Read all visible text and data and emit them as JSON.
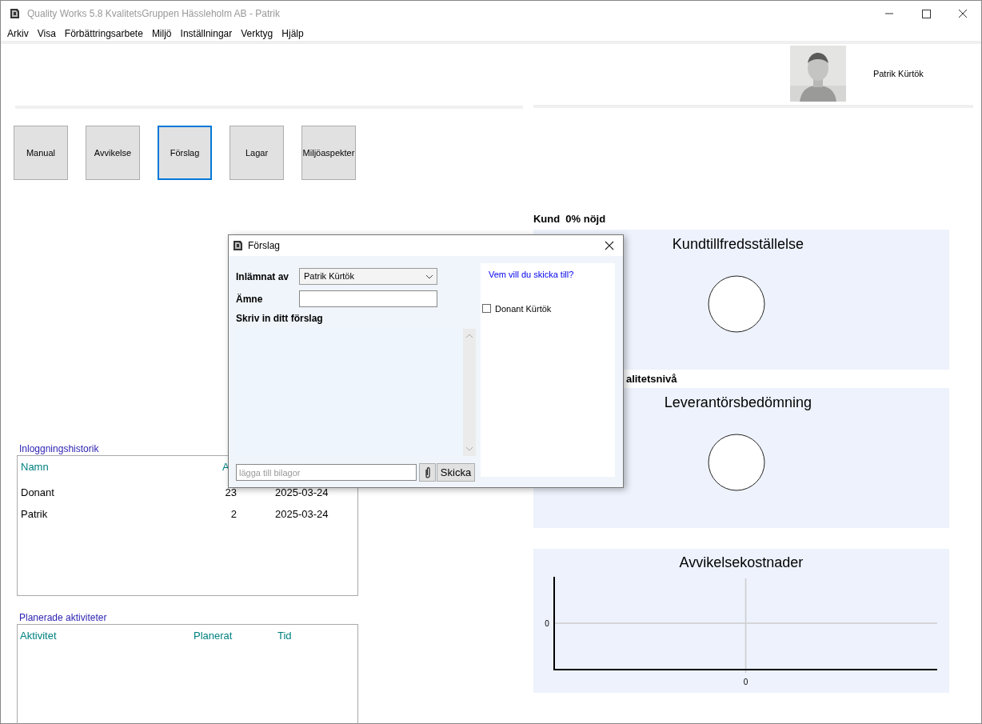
{
  "window": {
    "title": "Quality Works 5.8 KvalitetsGruppen Hässleholm AB - Patrik"
  },
  "menu": [
    "Arkiv",
    "Visa",
    "Förbättringsarbete",
    "Miljö",
    "Inställningar",
    "Verktyg",
    "Hjälp"
  ],
  "user": {
    "name": "Patrik Kürtök"
  },
  "buttons": [
    {
      "label": "Manual",
      "selected": false
    },
    {
      "label": "Avvikelse",
      "selected": false
    },
    {
      "label": "Förslag",
      "selected": true
    },
    {
      "label": "Lagar",
      "selected": false
    },
    {
      "label": "Miljöaspekter",
      "selected": false
    }
  ],
  "login_history": {
    "title": "Inloggningshistorik",
    "columns": [
      "Namn",
      "A"
    ],
    "rows": [
      [
        "Donant",
        "23",
        "2025-03-24"
      ],
      [
        "Patrik",
        "2",
        "2025-03-24"
      ]
    ]
  },
  "planned": {
    "title": "Planerade aktiviteter",
    "columns": [
      "Aktivitet",
      "Planerat",
      "Tid"
    ]
  },
  "customer": {
    "label": "Kund  0% nöjd",
    "panel_title": "Kundtillfredsställelse"
  },
  "quality": {
    "label": "alitetsnivå",
    "panel_title": "Leverantörsbedömning"
  },
  "costs": {
    "title": "Avvikelsekostnader",
    "y_axis_label": "0",
    "x_axis_label": "0"
  },
  "dialog": {
    "title": "Förslag",
    "submitted_by_label": "Inlämnat av",
    "submitted_by": "Patrik Kürtök",
    "subject_label": "Ämne",
    "text_label": "Skriv in ditt förslag",
    "attachment": {
      "placeholder": "lägga till bilagor"
    },
    "send": "Skicka",
    "recipients_prompt": "Vem vill du skicka till?",
    "recipients": [
      {
        "label": "Donant Kürtök",
        "checked": false
      }
    ]
  }
}
